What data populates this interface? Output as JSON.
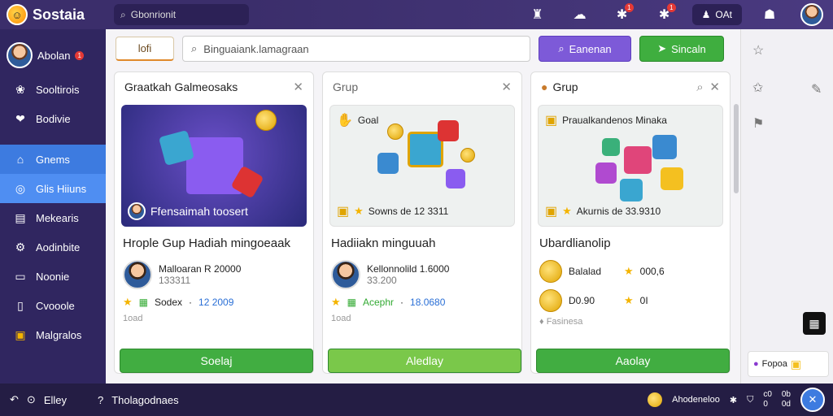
{
  "app": {
    "title": "Sostaia"
  },
  "topbar": {
    "search_value": "Gbonrionit",
    "pill_label": "OAt",
    "icons": [
      "trophy-icon",
      "chat-icon",
      "puzzle-icon",
      "puzzle-alert-icon",
      "user-icon",
      "notification-icon"
    ],
    "badge_count_1": "1",
    "badge_count_2": "1"
  },
  "sidebar": {
    "user_label": "Abolan",
    "user_badge": "1",
    "items": [
      {
        "label": "Sooltirois",
        "icon": "friends-icon"
      },
      {
        "label": "Bodivie",
        "icon": "heart-icon"
      },
      {
        "label": "Gnems",
        "icon": "home-icon"
      },
      {
        "label": "Glis Hiiuns",
        "icon": "compass-icon"
      },
      {
        "label": "Mekearis",
        "icon": "list-icon"
      },
      {
        "label": "Aodinbite",
        "icon": "settings-icon"
      },
      {
        "label": "Noonie",
        "icon": "monitor-icon"
      },
      {
        "label": "Cvooole",
        "icon": "document-icon"
      },
      {
        "label": "Malgralos",
        "icon": "gift-icon"
      }
    ]
  },
  "toolbar": {
    "tab_label": "lofi",
    "search_placeholder": "Binguaiank.lamagraan",
    "purple_button": "Eanenan",
    "green_button": "Sincaln"
  },
  "cards": [
    {
      "header": "Graatkah Galmeosaks",
      "image_caption": "Ffensaimah toosert",
      "subtitle": "Hrople Gup Hadiah mingoeaak",
      "person_line1": "Malloaran R 20000",
      "person_line2": "133311",
      "stat_label": "Sodex",
      "stat_value": "12 2009",
      "muted": "1oad",
      "button": "Soelaj"
    },
    {
      "header": "Grup",
      "image_top": "Goal",
      "image_caption": "Sowns de 12 3311",
      "subtitle": "Hadiiakn minguuah",
      "person_line1": "Kellonnolild 1.6000",
      "person_line2": "33.200",
      "stat_label": "Acephr",
      "stat_value": "18.0680",
      "muted": "1oad",
      "button": "Aledlay"
    },
    {
      "header": "Grup",
      "image_top": "Praualkandenos Minaka",
      "image_caption": "Akurnis de 33.9310",
      "subtitle": "Ubardlianolip",
      "row1_label": "Balalad",
      "row1_value": "000,6",
      "row2_label": "D0.90",
      "row2_value": "0I",
      "muted": "Fasinesa",
      "button": "Aaolay"
    }
  ],
  "rightpanel": {
    "promo_label": "Fopoa"
  },
  "bottombar": {
    "left_label": "Elley",
    "center_label": "Tholagodnaes",
    "coin_label": "Ahodeneloo",
    "mini1_a": "c0",
    "mini1_b": "0",
    "mini2_a": "0b",
    "mini2_b": "0d"
  },
  "colors": {
    "topbar": "#3b2e6b",
    "sidebar": "#302660",
    "accent_blue": "#3d7be0",
    "green": "#41ad41",
    "purple": "#7d5ad8"
  }
}
